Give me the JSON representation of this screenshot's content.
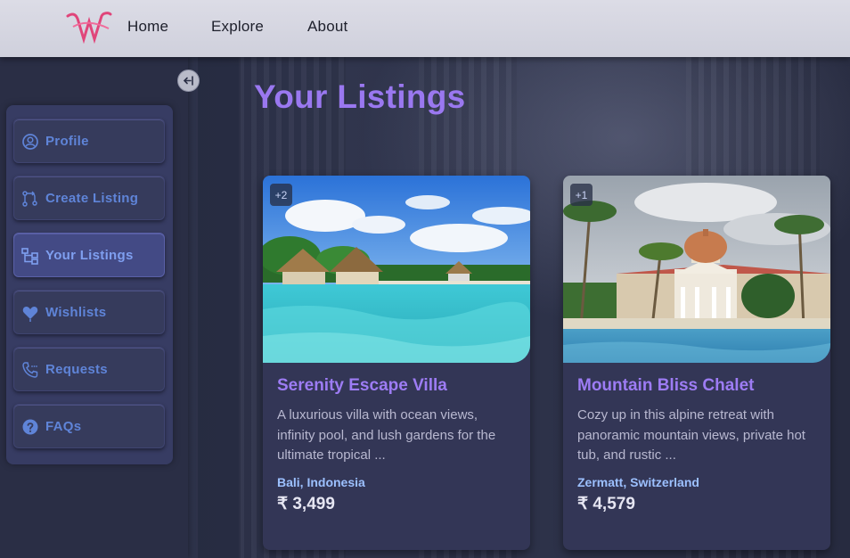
{
  "nav": {
    "home": "Home",
    "explore": "Explore",
    "about": "About"
  },
  "sidebar": {
    "items": [
      {
        "label": "Profile",
        "icon": "user-circle-icon"
      },
      {
        "label": "Create Listing",
        "icon": "git-branch-icon"
      },
      {
        "label": "Your Listings",
        "icon": "sitemap-icon",
        "active": true
      },
      {
        "label": "Wishlists",
        "icon": "heart-icon"
      },
      {
        "label": "Requests",
        "icon": "phone-icon"
      },
      {
        "label": "FAQs",
        "icon": "question-icon"
      }
    ]
  },
  "page": {
    "title": "Your Listings"
  },
  "listings": [
    {
      "badge": "+2",
      "title": "Serenity Escape Villa",
      "description": "A luxurious villa with ocean views, infinity pool, and lush gardens for the ultimate tropical ...",
      "location": "Bali, Indonesia",
      "price": "₹ 3,499"
    },
    {
      "badge": "+1",
      "title": "Mountain Bliss Chalet",
      "description": "Cozy up in this alpine retreat with panoramic mountain views, private hot tub, and rustic ...",
      "location": "Zermatt, Switzerland",
      "price": "₹ 4,579"
    }
  ],
  "colors": {
    "accent": "#9a78f0",
    "menu_label": "#5f84d8",
    "location": "#9cc0ff"
  }
}
